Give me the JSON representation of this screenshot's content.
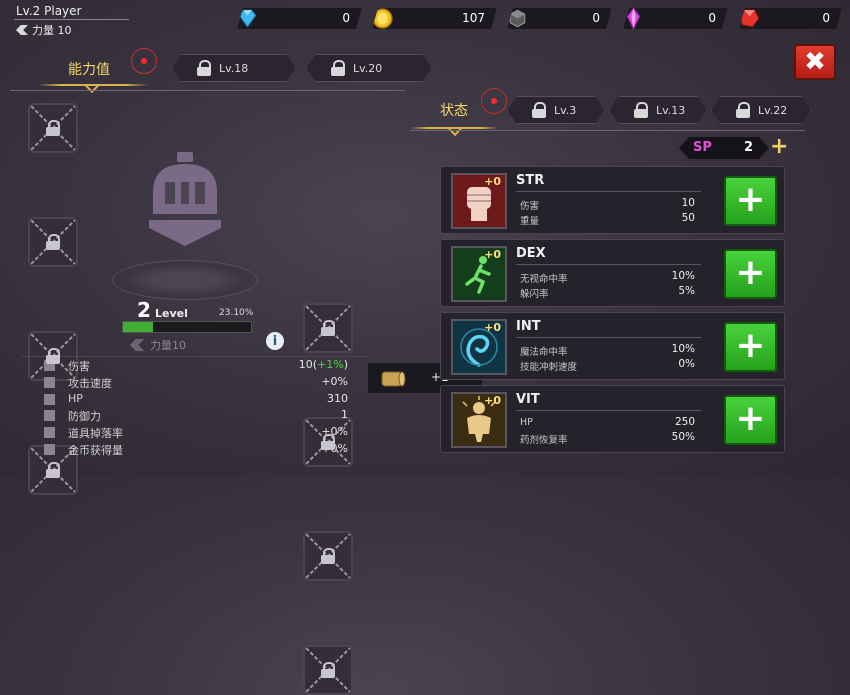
{
  "player": {
    "name": "Lv.2 Player",
    "power_label": "力量 10"
  },
  "currencies": [
    {
      "icon": "diamond-icon",
      "value": "0",
      "color": "#3fb8f0"
    },
    {
      "icon": "gold-coin-icon",
      "value": "107",
      "color": "#f1c21b"
    },
    {
      "icon": "ore-icon",
      "value": "0",
      "color": "#9a9a9a"
    },
    {
      "icon": "purple-crystal-icon",
      "value": "0",
      "color": "#d94ae0"
    },
    {
      "icon": "red-gem-icon",
      "value": "0",
      "color": "#e3352a"
    }
  ],
  "tabs": {
    "ability": "能力值",
    "ability_locked": [
      "Lv.18",
      "Lv.20"
    ],
    "status": "状态",
    "status_locked": [
      "Lv.3",
      "Lv.13",
      "Lv.22"
    ]
  },
  "character": {
    "level": "2",
    "level_word": "Level",
    "exp_percent_label": "23.10%",
    "exp_fraction": 0.231,
    "power_label": "力量10"
  },
  "stats": [
    {
      "icon": "damage-icon",
      "label": "伤害",
      "value": "10(",
      "highlight": "+1%",
      "suffix": ")"
    },
    {
      "icon": "attack-speed-icon",
      "label": "攻击速度",
      "value": "+0%",
      "highlight": "",
      "suffix": ""
    },
    {
      "icon": "heart-icon",
      "label": "HP",
      "value": "310",
      "highlight": "",
      "suffix": ""
    },
    {
      "icon": "shield-icon",
      "label": "防御力",
      "value": "1",
      "highlight": "",
      "suffix": ""
    },
    {
      "icon": "drop-rate-icon",
      "label": "道具掉落率",
      "value": "+0%",
      "highlight": "",
      "suffix": ""
    },
    {
      "icon": "gold-gain-icon",
      "label": "金币获得量",
      "value": "+0%",
      "highlight": "",
      "suffix": ""
    }
  ],
  "scroll": {
    "icon": "scroll-icon",
    "value": "+1"
  },
  "sp": {
    "label": "SP",
    "value": "2"
  },
  "attributes": [
    {
      "name": "STR",
      "bonus": "+0",
      "icon": "fist-icon",
      "color": "#8a1e1e",
      "rows": [
        {
          "label": "伤害",
          "value": "10"
        },
        {
          "label": "重量",
          "value": "50"
        }
      ]
    },
    {
      "name": "DEX",
      "bonus": "+0",
      "icon": "running-man-icon",
      "color": "#1e6a2a",
      "rows": [
        {
          "label": "无视命中率",
          "value": "10%"
        },
        {
          "label": "躲闪率",
          "value": "5%"
        }
      ]
    },
    {
      "name": "INT",
      "bonus": "+0",
      "icon": "magic-swirl-icon",
      "color": "#1e5f7a",
      "rows": [
        {
          "label": "魔法命中率",
          "value": "10%"
        },
        {
          "label": "技能冲刺速度",
          "value": "0%"
        }
      ]
    },
    {
      "name": "VIT",
      "bonus": "+0",
      "icon": "body-icon",
      "color": "#8a6a1e",
      "rows": [
        {
          "label": "HP",
          "value": "250"
        },
        {
          "label": "药剂恢复率",
          "value": "50%"
        }
      ]
    }
  ]
}
